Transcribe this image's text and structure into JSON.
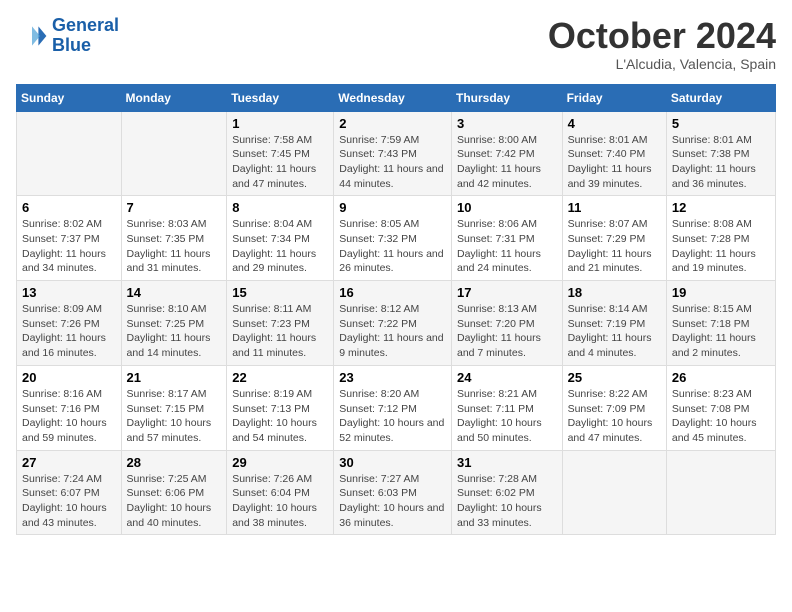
{
  "header": {
    "logo_line1": "General",
    "logo_line2": "Blue",
    "month": "October 2024",
    "location": "L'Alcudia, Valencia, Spain"
  },
  "days_of_week": [
    "Sunday",
    "Monday",
    "Tuesday",
    "Wednesday",
    "Thursday",
    "Friday",
    "Saturday"
  ],
  "weeks": [
    [
      {
        "num": "",
        "sunrise": "",
        "sunset": "",
        "daylight": ""
      },
      {
        "num": "",
        "sunrise": "",
        "sunset": "",
        "daylight": ""
      },
      {
        "num": "1",
        "sunrise": "Sunrise: 7:58 AM",
        "sunset": "Sunset: 7:45 PM",
        "daylight": "Daylight: 11 hours and 47 minutes."
      },
      {
        "num": "2",
        "sunrise": "Sunrise: 7:59 AM",
        "sunset": "Sunset: 7:43 PM",
        "daylight": "Daylight: 11 hours and 44 minutes."
      },
      {
        "num": "3",
        "sunrise": "Sunrise: 8:00 AM",
        "sunset": "Sunset: 7:42 PM",
        "daylight": "Daylight: 11 hours and 42 minutes."
      },
      {
        "num": "4",
        "sunrise": "Sunrise: 8:01 AM",
        "sunset": "Sunset: 7:40 PM",
        "daylight": "Daylight: 11 hours and 39 minutes."
      },
      {
        "num": "5",
        "sunrise": "Sunrise: 8:01 AM",
        "sunset": "Sunset: 7:38 PM",
        "daylight": "Daylight: 11 hours and 36 minutes."
      }
    ],
    [
      {
        "num": "6",
        "sunrise": "Sunrise: 8:02 AM",
        "sunset": "Sunset: 7:37 PM",
        "daylight": "Daylight: 11 hours and 34 minutes."
      },
      {
        "num": "7",
        "sunrise": "Sunrise: 8:03 AM",
        "sunset": "Sunset: 7:35 PM",
        "daylight": "Daylight: 11 hours and 31 minutes."
      },
      {
        "num": "8",
        "sunrise": "Sunrise: 8:04 AM",
        "sunset": "Sunset: 7:34 PM",
        "daylight": "Daylight: 11 hours and 29 minutes."
      },
      {
        "num": "9",
        "sunrise": "Sunrise: 8:05 AM",
        "sunset": "Sunset: 7:32 PM",
        "daylight": "Daylight: 11 hours and 26 minutes."
      },
      {
        "num": "10",
        "sunrise": "Sunrise: 8:06 AM",
        "sunset": "Sunset: 7:31 PM",
        "daylight": "Daylight: 11 hours and 24 minutes."
      },
      {
        "num": "11",
        "sunrise": "Sunrise: 8:07 AM",
        "sunset": "Sunset: 7:29 PM",
        "daylight": "Daylight: 11 hours and 21 minutes."
      },
      {
        "num": "12",
        "sunrise": "Sunrise: 8:08 AM",
        "sunset": "Sunset: 7:28 PM",
        "daylight": "Daylight: 11 hours and 19 minutes."
      }
    ],
    [
      {
        "num": "13",
        "sunrise": "Sunrise: 8:09 AM",
        "sunset": "Sunset: 7:26 PM",
        "daylight": "Daylight: 11 hours and 16 minutes."
      },
      {
        "num": "14",
        "sunrise": "Sunrise: 8:10 AM",
        "sunset": "Sunset: 7:25 PM",
        "daylight": "Daylight: 11 hours and 14 minutes."
      },
      {
        "num": "15",
        "sunrise": "Sunrise: 8:11 AM",
        "sunset": "Sunset: 7:23 PM",
        "daylight": "Daylight: 11 hours and 11 minutes."
      },
      {
        "num": "16",
        "sunrise": "Sunrise: 8:12 AM",
        "sunset": "Sunset: 7:22 PM",
        "daylight": "Daylight: 11 hours and 9 minutes."
      },
      {
        "num": "17",
        "sunrise": "Sunrise: 8:13 AM",
        "sunset": "Sunset: 7:20 PM",
        "daylight": "Daylight: 11 hours and 7 minutes."
      },
      {
        "num": "18",
        "sunrise": "Sunrise: 8:14 AM",
        "sunset": "Sunset: 7:19 PM",
        "daylight": "Daylight: 11 hours and 4 minutes."
      },
      {
        "num": "19",
        "sunrise": "Sunrise: 8:15 AM",
        "sunset": "Sunset: 7:18 PM",
        "daylight": "Daylight: 11 hours and 2 minutes."
      }
    ],
    [
      {
        "num": "20",
        "sunrise": "Sunrise: 8:16 AM",
        "sunset": "Sunset: 7:16 PM",
        "daylight": "Daylight: 10 hours and 59 minutes."
      },
      {
        "num": "21",
        "sunrise": "Sunrise: 8:17 AM",
        "sunset": "Sunset: 7:15 PM",
        "daylight": "Daylight: 10 hours and 57 minutes."
      },
      {
        "num": "22",
        "sunrise": "Sunrise: 8:19 AM",
        "sunset": "Sunset: 7:13 PM",
        "daylight": "Daylight: 10 hours and 54 minutes."
      },
      {
        "num": "23",
        "sunrise": "Sunrise: 8:20 AM",
        "sunset": "Sunset: 7:12 PM",
        "daylight": "Daylight: 10 hours and 52 minutes."
      },
      {
        "num": "24",
        "sunrise": "Sunrise: 8:21 AM",
        "sunset": "Sunset: 7:11 PM",
        "daylight": "Daylight: 10 hours and 50 minutes."
      },
      {
        "num": "25",
        "sunrise": "Sunrise: 8:22 AM",
        "sunset": "Sunset: 7:09 PM",
        "daylight": "Daylight: 10 hours and 47 minutes."
      },
      {
        "num": "26",
        "sunrise": "Sunrise: 8:23 AM",
        "sunset": "Sunset: 7:08 PM",
        "daylight": "Daylight: 10 hours and 45 minutes."
      }
    ],
    [
      {
        "num": "27",
        "sunrise": "Sunrise: 7:24 AM",
        "sunset": "Sunset: 6:07 PM",
        "daylight": "Daylight: 10 hours and 43 minutes."
      },
      {
        "num": "28",
        "sunrise": "Sunrise: 7:25 AM",
        "sunset": "Sunset: 6:06 PM",
        "daylight": "Daylight: 10 hours and 40 minutes."
      },
      {
        "num": "29",
        "sunrise": "Sunrise: 7:26 AM",
        "sunset": "Sunset: 6:04 PM",
        "daylight": "Daylight: 10 hours and 38 minutes."
      },
      {
        "num": "30",
        "sunrise": "Sunrise: 7:27 AM",
        "sunset": "Sunset: 6:03 PM",
        "daylight": "Daylight: 10 hours and 36 minutes."
      },
      {
        "num": "31",
        "sunrise": "Sunrise: 7:28 AM",
        "sunset": "Sunset: 6:02 PM",
        "daylight": "Daylight: 10 hours and 33 minutes."
      },
      {
        "num": "",
        "sunrise": "",
        "sunset": "",
        "daylight": ""
      },
      {
        "num": "",
        "sunrise": "",
        "sunset": "",
        "daylight": ""
      }
    ]
  ]
}
